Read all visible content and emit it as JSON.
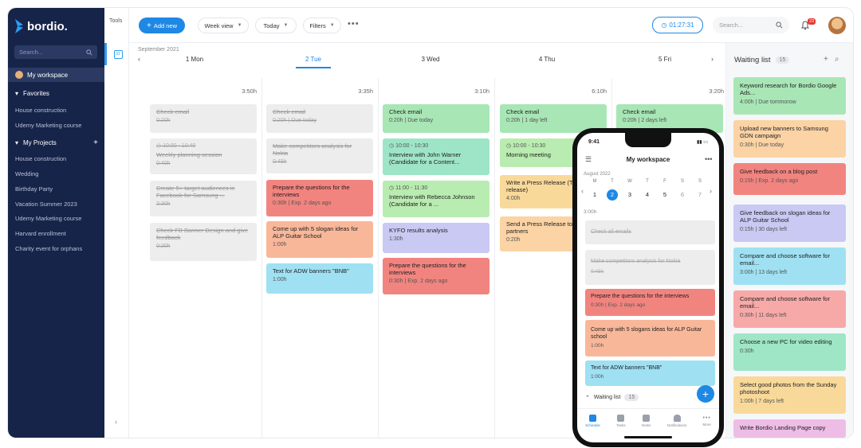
{
  "sidebar": {
    "logo": "bordio.",
    "search_placeholder": "Search...",
    "workspace": "My workspace",
    "favorites": "Favorites",
    "favorite_items": [
      "House construction",
      "Udemy Marketing course"
    ],
    "my_projects": "My Projects",
    "project_items": [
      "House construction",
      "Wedding",
      "Birthday Party",
      "Vacation Summer 2023",
      "Udemy Marketing course",
      "Harvard enrollment",
      "Charity event for orphans"
    ]
  },
  "tools": {
    "label": "Tools",
    "cal_icon_text": "31"
  },
  "topbar": {
    "add_new": "Add new",
    "week_view": "Week view",
    "today": "Today",
    "filters": "Filters",
    "timer": "01:27:31",
    "search_placeholder": "Search...",
    "notif_count": "23"
  },
  "calendar": {
    "month": "September 2021",
    "days": [
      {
        "label": "1 Mon",
        "total": "3:50h"
      },
      {
        "label": "2 Tue",
        "total": "3:35h"
      },
      {
        "label": "3 Wed",
        "total": "3:10h"
      },
      {
        "label": "4 Thu",
        "total": "6:10h"
      },
      {
        "label": "5 Fri",
        "total": "3:20h"
      }
    ],
    "cards": {
      "mon": [
        {
          "title": "Check email",
          "meta": "0:20h"
        },
        {
          "time": "10:00 - 10:40",
          "title": "Weekly planning session",
          "meta": "0:40h"
        },
        {
          "title": "Create 5+ target audiences in Facebook for Samsung ...",
          "meta": "2:30h"
        },
        {
          "title": "Check FB Banner Design and give feedback",
          "meta": "0:20h"
        }
      ],
      "tue": [
        {
          "title": "Check email",
          "meta": "0:20h | Due today"
        },
        {
          "title": "Make competitors analysis for Nokia",
          "meta": "0:45h"
        },
        {
          "title": "Prepare the questions for the interviews",
          "meta": "0:30h | Exp. 2 days ago"
        },
        {
          "title": "Come up with 5 slogan ideas for ALP Guitar School",
          "meta": "1:00h"
        },
        {
          "title": "Text for ADW banners \"BNB\"",
          "meta": "1:00h"
        }
      ],
      "wed": [
        {
          "title": "Check email",
          "meta": "0:20h | Due today"
        },
        {
          "time": "10:00 - 10:30",
          "title": "Interview with John Warner (Candidate for a Content..."
        },
        {
          "time": "11:00 - 11:30",
          "title": "Interview with Rebecca Johnson (Candidate for a ..."
        },
        {
          "title": "KYFO results analysis",
          "meta": "1:30h"
        },
        {
          "title": "Prepare the questions for the interviews",
          "meta": "0:30h | Exp. 2 days ago"
        }
      ],
      "thu": [
        {
          "title": "Check email",
          "meta": "0:20h | 1 day left"
        },
        {
          "time": "10:00 - 10:30",
          "title": "Morning meeting"
        },
        {
          "title": "Write a Press Release (Tim feature release)",
          "meta": "4:00h"
        },
        {
          "title": "Send a Press Release to ou partners",
          "meta": "0:20h"
        }
      ],
      "fri": [
        {
          "title": "Check email",
          "meta": "0:20h | 2 days left"
        }
      ]
    }
  },
  "waiting": {
    "title": "Waiting list",
    "count": "15",
    "cards": [
      {
        "title": "Keyword research for Bordio Google Ads...",
        "meta": "4:00h | Due tommorow"
      },
      {
        "title": "Upload new banners to Samsung GDN campaign",
        "meta": "0:30h | Due today"
      },
      {
        "title": "Give feedback on a blog post",
        "meta": "0:15h | Exp. 2 days ago"
      },
      {
        "title": "Give feedback on slogan ideas for ALP Guitar School",
        "meta": "0:15h | 30 days left"
      },
      {
        "title": "Compare and choose software for email...",
        "meta": "3:00h | 13 days left"
      },
      {
        "title": "Compare and choose software for email...",
        "meta": "0:30h | 11 days left"
      },
      {
        "title": "Choose a new PC for video editing",
        "meta": "0:30h"
      },
      {
        "title": "Select good photos from the Sunday photoshoot",
        "meta": "1:00h | 7 days left"
      },
      {
        "title": "Write Bordio Landing Page copy",
        "meta": ""
      }
    ]
  },
  "phone": {
    "time": "9:41",
    "title": "My workspace",
    "month": "August 2022",
    "weekdays": [
      "M",
      "T",
      "W",
      "T",
      "F",
      "S",
      "S"
    ],
    "dates": [
      "1",
      "2",
      "3",
      "4",
      "5",
      "6",
      "7"
    ],
    "total": "3:00h",
    "cards": [
      {
        "title": "Check all emails",
        "meta": ""
      },
      {
        "title": "Make competitors analysis for Nokia",
        "meta": "0:45h"
      },
      {
        "title": "Prepare the questions for the interviews",
        "meta": "0:30h | Exp. 2 days ago"
      },
      {
        "title": "Come up with 5 slogans ideas for ALP Guitar school",
        "meta": "1:00h"
      },
      {
        "title": "Text for ADW banners \"BNB\"",
        "meta": "1:00h"
      }
    ],
    "waiting": "Waiting list",
    "waiting_count": "15",
    "tabs": [
      "Schedule",
      "Tasks",
      "Notes",
      "Notifications",
      "More"
    ]
  },
  "colors": {
    "accent": "#1e88e5",
    "sidebar": "#172449"
  }
}
